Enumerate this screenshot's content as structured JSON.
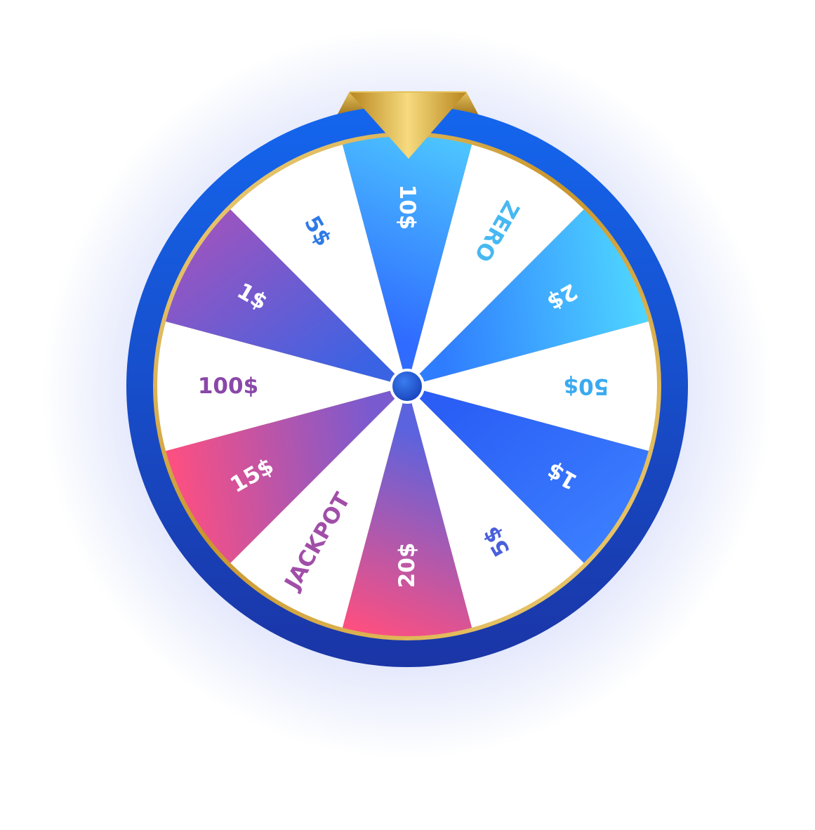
{
  "wheel": {
    "segments": [
      {
        "label": "10$",
        "style": "gradient",
        "colors": [
          "#4dc6ff",
          "#2f6bff"
        ],
        "text_color": "#ffffff"
      },
      {
        "label": "ZERO",
        "style": "plain",
        "text_color": "#47b8f2"
      },
      {
        "label": "2$",
        "style": "gradient",
        "colors": [
          "#4fd6ff",
          "#2f7dff"
        ],
        "text_color": "#ffffff"
      },
      {
        "label": "50$",
        "style": "plain",
        "text_color": "#3aaaf0"
      },
      {
        "label": "1$",
        "style": "gradient",
        "colors": [
          "#3b7eff",
          "#2a5ef5"
        ],
        "text_color": "#ffffff"
      },
      {
        "label": "5$",
        "style": "plain",
        "text_color": "#4a5fdc"
      },
      {
        "label": "20$",
        "style": "gradient",
        "colors": [
          "#ff4f7f",
          "#5b63de"
        ],
        "text_color": "#ffffff"
      },
      {
        "label": "JACKPOT",
        "style": "plain",
        "text_color": "#a14ea8"
      },
      {
        "label": "15$",
        "style": "gradient",
        "colors": [
          "#ff4f80",
          "#7a5acf"
        ],
        "text_color": "#ffffff"
      },
      {
        "label": "100$",
        "style": "plain",
        "text_color": "#8a47a8"
      },
      {
        "label": "1$",
        "style": "gradient",
        "colors": [
          "#9a55c0",
          "#3a63e4"
        ],
        "text_color": "#ffffff"
      },
      {
        "label": "5$",
        "style": "plain",
        "text_color": "#2f7ae8"
      }
    ]
  },
  "colors": {
    "rim_top": "#1466ee",
    "rim_bottom": "#1a35a6",
    "plain_segment": "#ffffff",
    "gold": "#d3a63a",
    "hub": "#1d55d0",
    "glow": "#4c6ae8"
  },
  "pointer": {
    "icon": "gold-triangle-pointer-icon"
  },
  "hub": {
    "icon": "center-hub-icon"
  }
}
